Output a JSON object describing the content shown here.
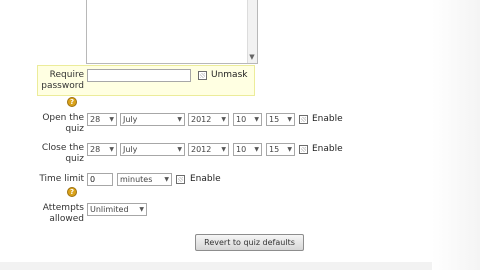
{
  "description_field": {
    "value": ""
  },
  "password": {
    "label_line1": "Require",
    "label_line2": "password",
    "value": "",
    "unmask_label": "Unmask",
    "help_glyph": "?"
  },
  "open_quiz": {
    "label_line1": "Open the",
    "label_line2": "quiz",
    "day": "28",
    "month": "July",
    "year": "2012",
    "hour": "10",
    "minute": "15",
    "enable_label": "Enable"
  },
  "close_quiz": {
    "label_line1": "Close the",
    "label_line2": "quiz",
    "day": "28",
    "month": "July",
    "year": "2012",
    "hour": "10",
    "minute": "15",
    "enable_label": "Enable"
  },
  "time_limit": {
    "label": "Time limit",
    "value": "0",
    "unit": "minutes",
    "enable_label": "Enable",
    "help_glyph": "?"
  },
  "attempts": {
    "label_line1": "Attempts",
    "label_line2": "allowed",
    "value": "Unlimited"
  },
  "revert_button": {
    "label": "Revert to quiz defaults"
  },
  "colors": {
    "highlight": "#ffffe2",
    "help_icon": "#d9a21a"
  }
}
